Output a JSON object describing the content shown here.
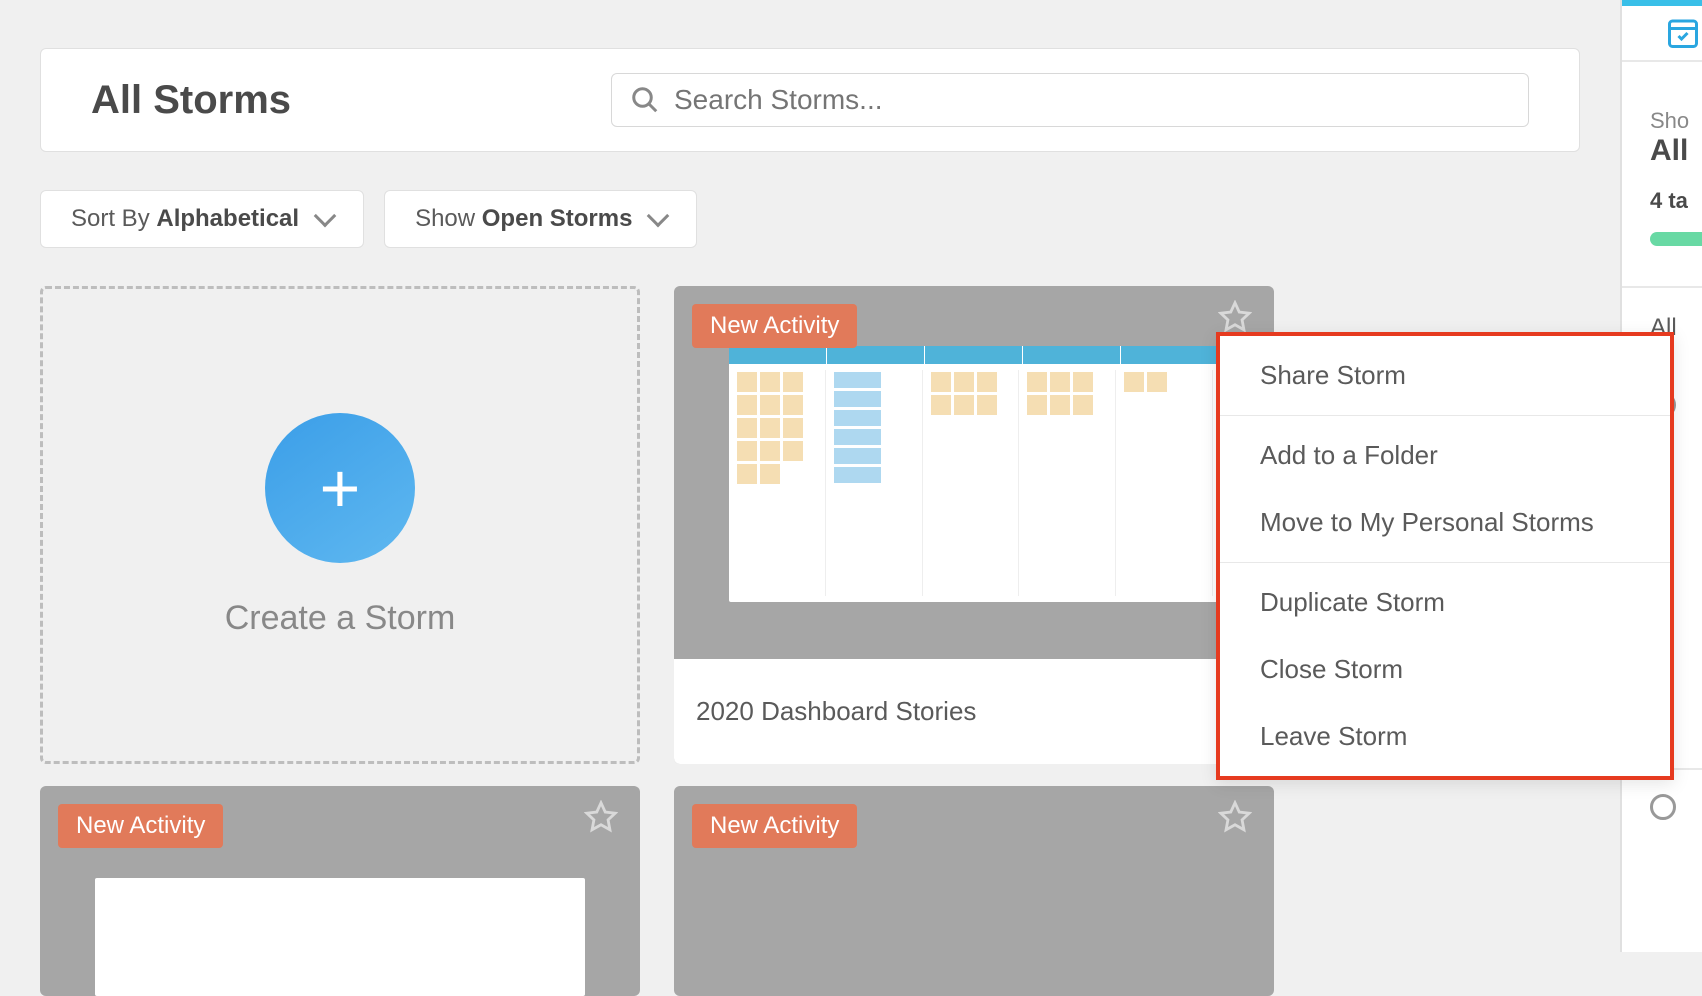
{
  "header": {
    "title": "All Storms",
    "search_placeholder": "Search Storms..."
  },
  "filters": {
    "sort_label": "Sort By ",
    "sort_value": "Alphabetical",
    "show_label": "Show ",
    "show_value": "Open Storms"
  },
  "create": {
    "label": "Create a Storm"
  },
  "storms": [
    {
      "title": "2020 Dashboard Stories",
      "badge": "New Activity"
    },
    {
      "title": "",
      "badge": "New Activity"
    },
    {
      "title": "",
      "badge": "New Activity"
    }
  ],
  "context_menu": {
    "groups": [
      [
        "Share Storm"
      ],
      [
        "Add to a Folder",
        "Move to My Personal Storms"
      ],
      [
        "Duplicate Storm",
        "Close Storm",
        "Leave Storm"
      ]
    ]
  },
  "sidebar": {
    "showing": "Sho",
    "title": "All",
    "count": "4 ta",
    "all_link": "All "
  }
}
